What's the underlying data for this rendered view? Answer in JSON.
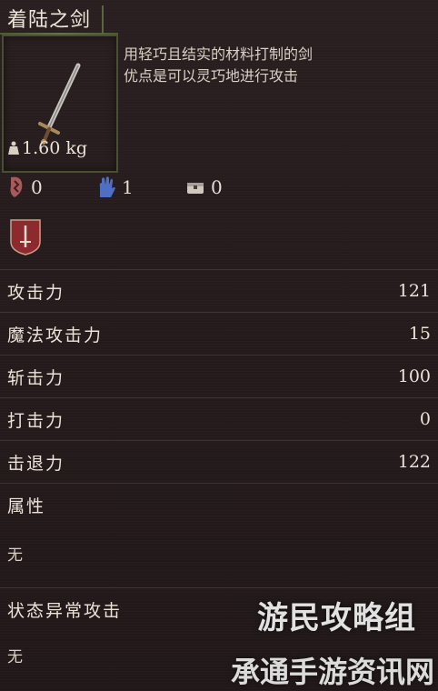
{
  "item": {
    "name": "着陆之剑",
    "description": "用轻巧且结实的材料打制的剑\n优点是可以灵巧地进行攻击",
    "weight": "1.60 kg",
    "weight_icon": "weight-icon"
  },
  "requirements": [
    {
      "icon": "strength-rune-icon",
      "value": "0",
      "color": "#c07070"
    },
    {
      "icon": "hand-magic-icon",
      "value": "1",
      "color": "#5a78c8"
    },
    {
      "icon": "chest-icon",
      "value": "0",
      "color": "#d8d0c4"
    }
  ],
  "category_badge": "sword-shield-icon",
  "stats": [
    {
      "label": "攻击力",
      "value": "121"
    },
    {
      "label": "魔法攻击力",
      "value": "15"
    },
    {
      "label": "斩击力",
      "value": "100"
    },
    {
      "label": "打击力",
      "value": "0"
    },
    {
      "label": "击退力",
      "value": "122"
    }
  ],
  "attributes": {
    "label": "属性",
    "value": "无"
  },
  "status_attack": {
    "label": "状态异常攻击",
    "value": "无"
  },
  "watermarks": {
    "line1": "游民攻略组",
    "line2": "承通手游资讯网"
  },
  "colors": {
    "background": "#241a1b",
    "vine": "#5a6440",
    "text": "#ece3d8",
    "badge": "#8c2a2e"
  }
}
